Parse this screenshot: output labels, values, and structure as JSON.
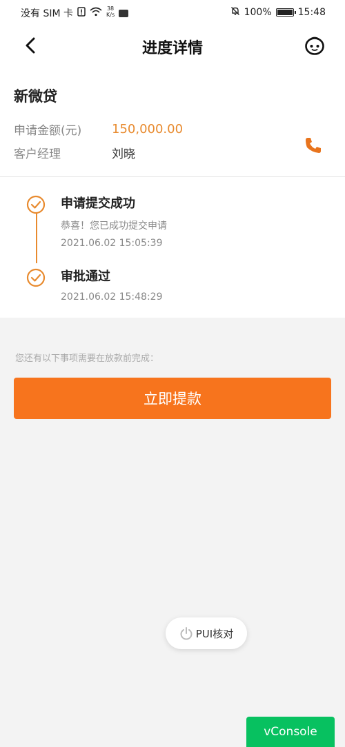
{
  "status_bar": {
    "carrier": "没有 SIM 卡",
    "net_speed_value": "38",
    "net_speed_unit": "K/s",
    "battery": "100%",
    "time": "15:48",
    "battery_level": 1.0
  },
  "header": {
    "title": "进度详情"
  },
  "product": {
    "name": "新微贷",
    "amount_label": "申请金额(元)",
    "amount_value": "150,000.00",
    "manager_label": "客户经理",
    "manager_value": "刘晓"
  },
  "timeline": [
    {
      "title": "申请提交成功",
      "desc": "恭喜！您已成功提交申请",
      "time": "2021.06.02 15:05:39"
    },
    {
      "title": "审批通过",
      "time": "2021.06.02 15:48:29"
    }
  ],
  "notice": "您还有以下事项需要在放款前完成：",
  "withdraw_button": "立即提款",
  "pui_button": "PUI核对",
  "vconsole_button": "vConsole",
  "colors": {
    "accent": "#e88a2e",
    "button": "#f7741d",
    "vconsole": "#07c160"
  }
}
